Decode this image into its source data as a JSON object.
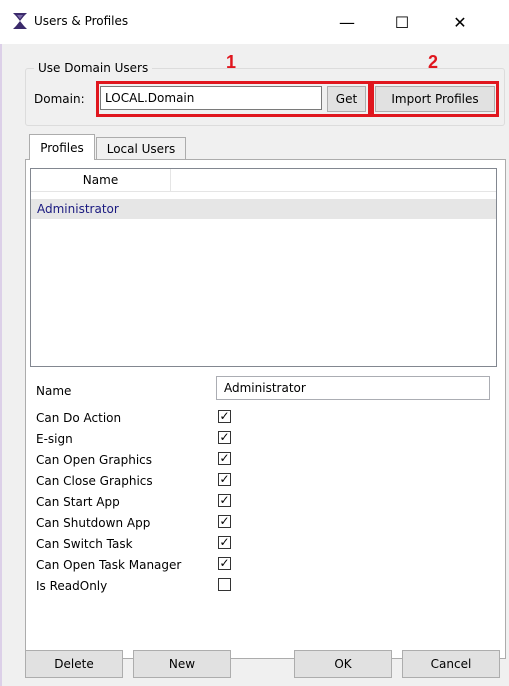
{
  "window": {
    "title": "Users & Profiles",
    "minimize": "—",
    "maximize": "☐",
    "close": "✕"
  },
  "domain_group": {
    "legend": "Use Domain Users",
    "domain_label": "Domain:",
    "domain_value": "LOCAL.Domain",
    "get_label": "Get",
    "import_label": "Import Profiles"
  },
  "annotations": {
    "a1": "1",
    "a2": "2"
  },
  "tabs": [
    {
      "label": "Profiles",
      "active": true
    },
    {
      "label": "Local Users",
      "active": false
    }
  ],
  "profiles_list": {
    "column": "Name",
    "rows": [
      {
        "name": "Administrator",
        "selected": true
      }
    ]
  },
  "properties": {
    "name_label": "Name",
    "name_value": "Administrator",
    "permissions": [
      {
        "label": "Can Do Action",
        "checked": true
      },
      {
        "label": "E-sign",
        "checked": true
      },
      {
        "label": "Can Open Graphics",
        "checked": true
      },
      {
        "label": "Can Close Graphics",
        "checked": true
      },
      {
        "label": "Can Start App",
        "checked": true
      },
      {
        "label": "Can Shutdown App",
        "checked": true
      },
      {
        "label": "Can Switch Task",
        "checked": true
      },
      {
        "label": "Can Open Task Manager",
        "checked": true
      },
      {
        "label": "Is ReadOnly",
        "checked": false
      }
    ]
  },
  "buttons": {
    "delete": "Delete",
    "new": "New",
    "ok": "OK",
    "cancel": "Cancel"
  },
  "colors": {
    "highlight": "#e0161e",
    "selected_row": "#e6e6e6",
    "selected_text": "#1a1a80"
  }
}
